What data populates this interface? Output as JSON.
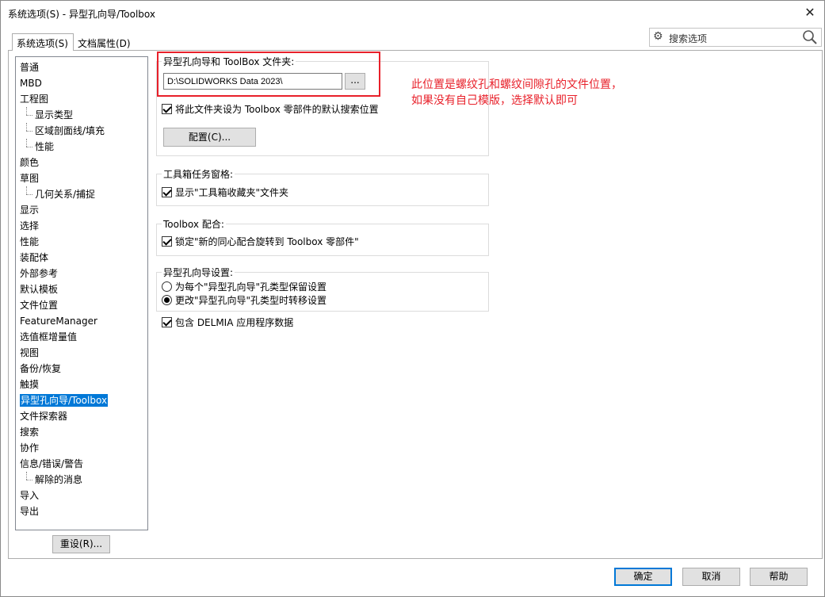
{
  "window": {
    "title": "系统选项(S) - 异型孔向导/Toolbox",
    "close_glyph": "✕"
  },
  "tabs": [
    {
      "label": "系统选项(S)"
    },
    {
      "label": "文档属性(D)"
    }
  ],
  "search": {
    "placeholder": "搜索选项"
  },
  "tree": {
    "items": [
      {
        "label": "普通"
      },
      {
        "label": "MBD"
      },
      {
        "label": "工程图"
      },
      {
        "label": "显示类型"
      },
      {
        "label": "区域剖面线/填充"
      },
      {
        "label": "性能"
      },
      {
        "label": "颜色"
      },
      {
        "label": "草图"
      },
      {
        "label": "几何关系/捕捉"
      },
      {
        "label": "显示"
      },
      {
        "label": "选择"
      },
      {
        "label": "性能"
      },
      {
        "label": "装配体"
      },
      {
        "label": "外部参考"
      },
      {
        "label": "默认模板"
      },
      {
        "label": "文件位置"
      },
      {
        "label": "FeatureManager"
      },
      {
        "label": "选值框增量值"
      },
      {
        "label": "视图"
      },
      {
        "label": "备份/恢复"
      },
      {
        "label": "触摸"
      },
      {
        "label": "异型孔向导/Toolbox"
      },
      {
        "label": "文件探索器"
      },
      {
        "label": "搜索"
      },
      {
        "label": "协作"
      },
      {
        "label": "信息/错误/警告"
      },
      {
        "label": "解除的消息"
      },
      {
        "label": "导入"
      },
      {
        "label": "导出"
      }
    ],
    "selected": "异型孔向导/Toolbox"
  },
  "reset_button": "重设(R)...",
  "folder_group": {
    "label": "异型孔向导和 ToolBox 文件夹:",
    "path_value": "D:\\SOLIDWORKS Data 2023\\",
    "browse_label": "...",
    "default_search_checkbox": "将此文件夹设为 Toolbox 零部件的默认搜索位置",
    "configure_button": "配置(C)..."
  },
  "task_pane_group": {
    "label": "工具箱任务窗格:",
    "checkbox": "显示\"工具箱收藏夹\"文件夹"
  },
  "mate_group": {
    "label": "Toolbox 配合:",
    "checkbox": "锁定\"新的同心配合旋转到 Toolbox 零部件\""
  },
  "hole_wizard_group": {
    "label": "异型孔向导设置:",
    "radio_1": "为每个\"异型孔向导\"孔类型保留设置",
    "radio_2": "更改\"异型孔向导\"孔类型时转移设置"
  },
  "delmia_checkbox": "包含 DELMIA 应用程序数据",
  "annotation": {
    "line1": "此位置是螺纹孔和螺纹间隙孔的文件位置，",
    "line2": "如果没有自己模版，选择默认即可",
    "color": "#e8202a"
  },
  "footer": {
    "ok": "确定",
    "cancel": "取消",
    "help": "帮助"
  }
}
